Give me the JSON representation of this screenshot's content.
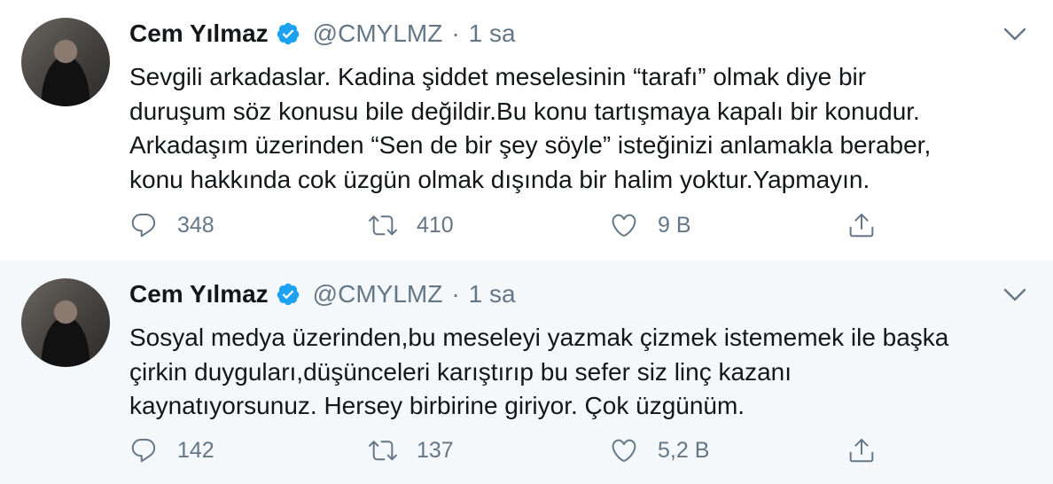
{
  "tweets": [
    {
      "author": {
        "name": "Cem Yılmaz",
        "handle": "@CMYLMZ",
        "verified": true
      },
      "separator": "·",
      "time": "1 sa",
      "text": "Sevgili arkadaslar. Kadina şiddet meselesinin “tarafı” olmak diye bir\nduruşum söz konusu bile değildir.Bu konu tartışmaya kapalı bir konudur.\nArkadaşım üzerinden “Sen de bir şey söyle” isteğinizi anlamakla beraber,\nkonu hakkında cok üzgün olmak dışında bir halim yoktur.Yapmayın.",
      "actions": {
        "replies": "348",
        "retweets": "410",
        "likes": "9 B"
      }
    },
    {
      "author": {
        "name": "Cem Yılmaz",
        "handle": "@CMYLMZ",
        "verified": true
      },
      "separator": "·",
      "time": "1 sa",
      "text": "Sosyal medya üzerinden,bu meseleyi yazmak çizmek istememek ile başka\nçirkin duyguları,düşünceleri karıştırıp bu sefer siz linç kazanı\nkaynatıyorsunuz. Hersey birbirine giriyor. Çok üzgünüm.",
      "actions": {
        "replies": "142",
        "retweets": "137",
        "likes": "5,2 B"
      }
    }
  ],
  "colors": {
    "verified": "#1da1f2",
    "secondary_text": "#657786",
    "thread_line": "#ccd6dd",
    "reply_background": "#f5f8fa"
  },
  "icons": [
    "verified-badge-icon",
    "chevron-down-icon",
    "reply-icon",
    "retweet-icon",
    "like-icon",
    "share-icon"
  ]
}
